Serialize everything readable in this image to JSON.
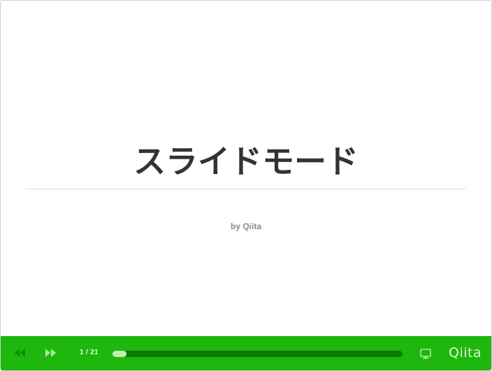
{
  "slide": {
    "title": "スライドモード",
    "author": "by Qiita"
  },
  "controls": {
    "page_counter": "1 / 21",
    "current_page": 1,
    "total_pages": 21,
    "progress_fraction": 0.048,
    "prev_icon": "rewind-icon",
    "next_icon": "fast-forward-icon",
    "presentation_icon": "monitor-icon",
    "brand": "Qiita"
  },
  "colors": {
    "accent": "#1db70e",
    "track": "#0d7a06",
    "progress": "#bff0b2",
    "title": "#333333",
    "author": "#8a8a8a"
  }
}
